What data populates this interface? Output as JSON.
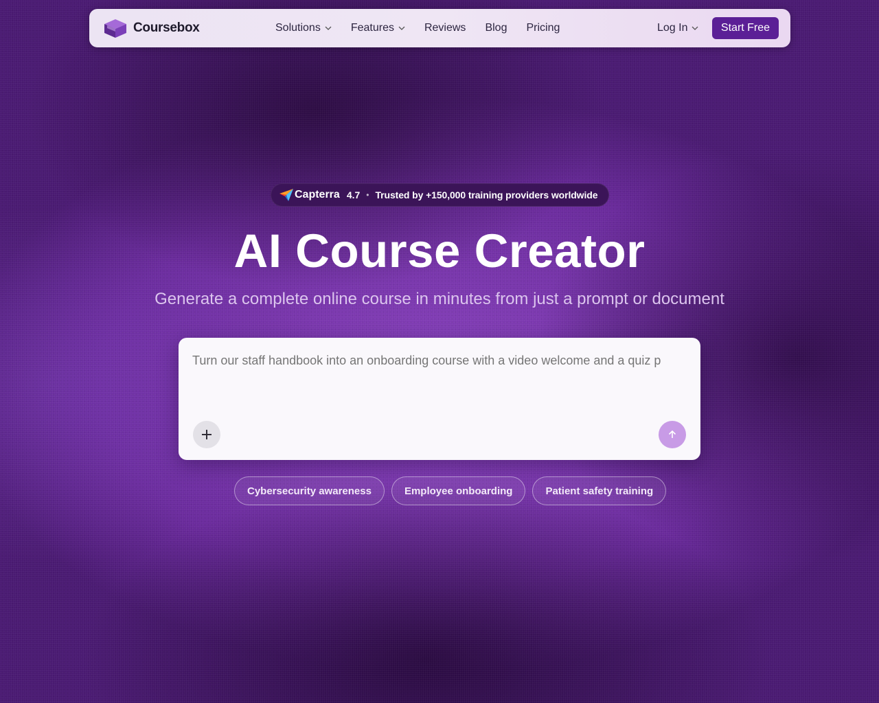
{
  "nav": {
    "logo_text": "Coursebox",
    "links": [
      {
        "label": "Solutions",
        "dropdown": true
      },
      {
        "label": "Features",
        "dropdown": true
      },
      {
        "label": "Reviews",
        "dropdown": false
      },
      {
        "label": "Blog",
        "dropdown": false
      },
      {
        "label": "Pricing",
        "dropdown": false
      }
    ],
    "login_label": "Log In",
    "start_label": "Start Free"
  },
  "badge": {
    "brand": "Capterra",
    "rating": "4.7",
    "separator": "•",
    "text": "Trusted by +150,000 training providers worldwide"
  },
  "hero": {
    "title": "AI Course Creator",
    "subtitle": "Generate a complete online course in minutes from just a prompt or document"
  },
  "prompt": {
    "placeholder": "Turn our staff handbook into an onboarding course with a video welcome and a quiz p",
    "plus_icon": "plus-icon",
    "send_icon": "arrow-up-icon"
  },
  "chips": [
    {
      "label": "Cybersecurity awareness"
    },
    {
      "label": "Employee onboarding"
    },
    {
      "label": "Patient safety training"
    }
  ],
  "colors": {
    "accent": "#5b1f96",
    "background": "#6a2a9c",
    "send_button": "#c89be6"
  }
}
